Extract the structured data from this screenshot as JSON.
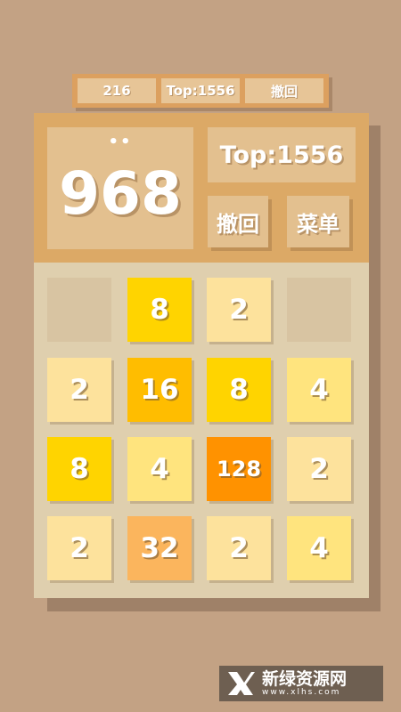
{
  "top_bar": {
    "score": "216",
    "best": "Top:1556",
    "undo": "撤回"
  },
  "header": {
    "indicator": "••",
    "score": "968",
    "best": "Top:1556",
    "undo_label": "撤回",
    "menu_label": "菜单"
  },
  "board": {
    "rows": 4,
    "cols": 4,
    "tiles": [
      [
        "",
        "8",
        "2",
        ""
      ],
      [
        "2",
        "16",
        "8",
        "4"
      ],
      [
        "8",
        "4",
        "128",
        "2"
      ],
      [
        "2",
        "32",
        "2",
        "4"
      ]
    ]
  },
  "tile_colors": {
    "empty": "#d8c4a2",
    "2": "#fde29c",
    "4": "#ffe47e",
    "8": "#ffd400",
    "16": "#ffbd00",
    "32": "#fbb55d",
    "128": "#ff9200"
  },
  "watermark": {
    "title": "新绿资源网",
    "subtitle": "www.xlhs.com",
    "icon": "xl-logo-icon"
  }
}
